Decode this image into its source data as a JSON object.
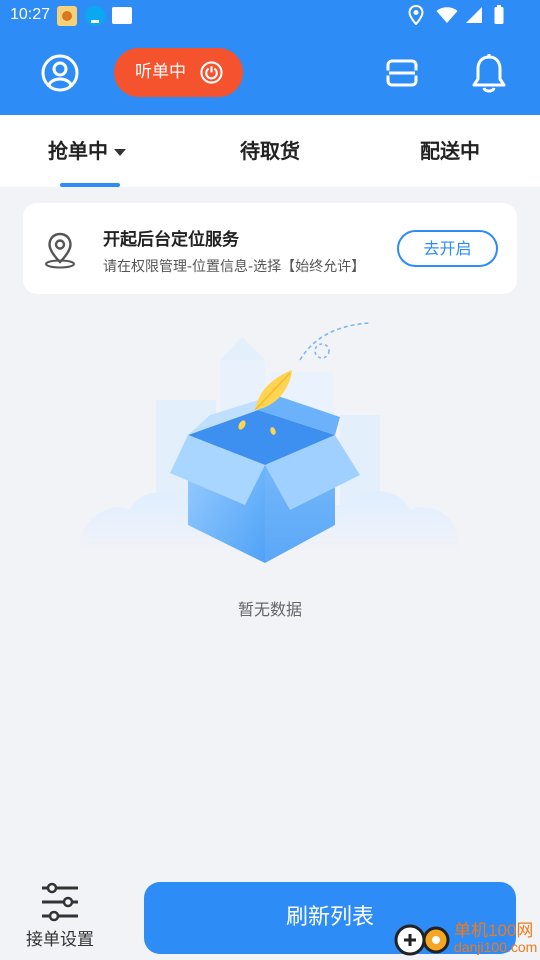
{
  "status_bar": {
    "time": "10:27"
  },
  "header": {
    "listen_label": "听单中"
  },
  "tabs": [
    {
      "label": "抢单中"
    },
    {
      "label": "待取货"
    },
    {
      "label": "配送中"
    }
  ],
  "location_card": {
    "title": "开起后台定位服务",
    "subtitle": "请在权限管理-位置信息-选择【始终允许】",
    "button_label": "去开启"
  },
  "empty_state": {
    "text": "暂无数据"
  },
  "bottom": {
    "settings_label": "接单设置",
    "refresh_label": "刷新列表"
  },
  "watermark": {
    "line1": "单机100网",
    "line2": "danji100.com"
  },
  "colors": {
    "primary": "#2e8cf6",
    "accent": "#f5522e",
    "background": "#f2f3f7"
  }
}
